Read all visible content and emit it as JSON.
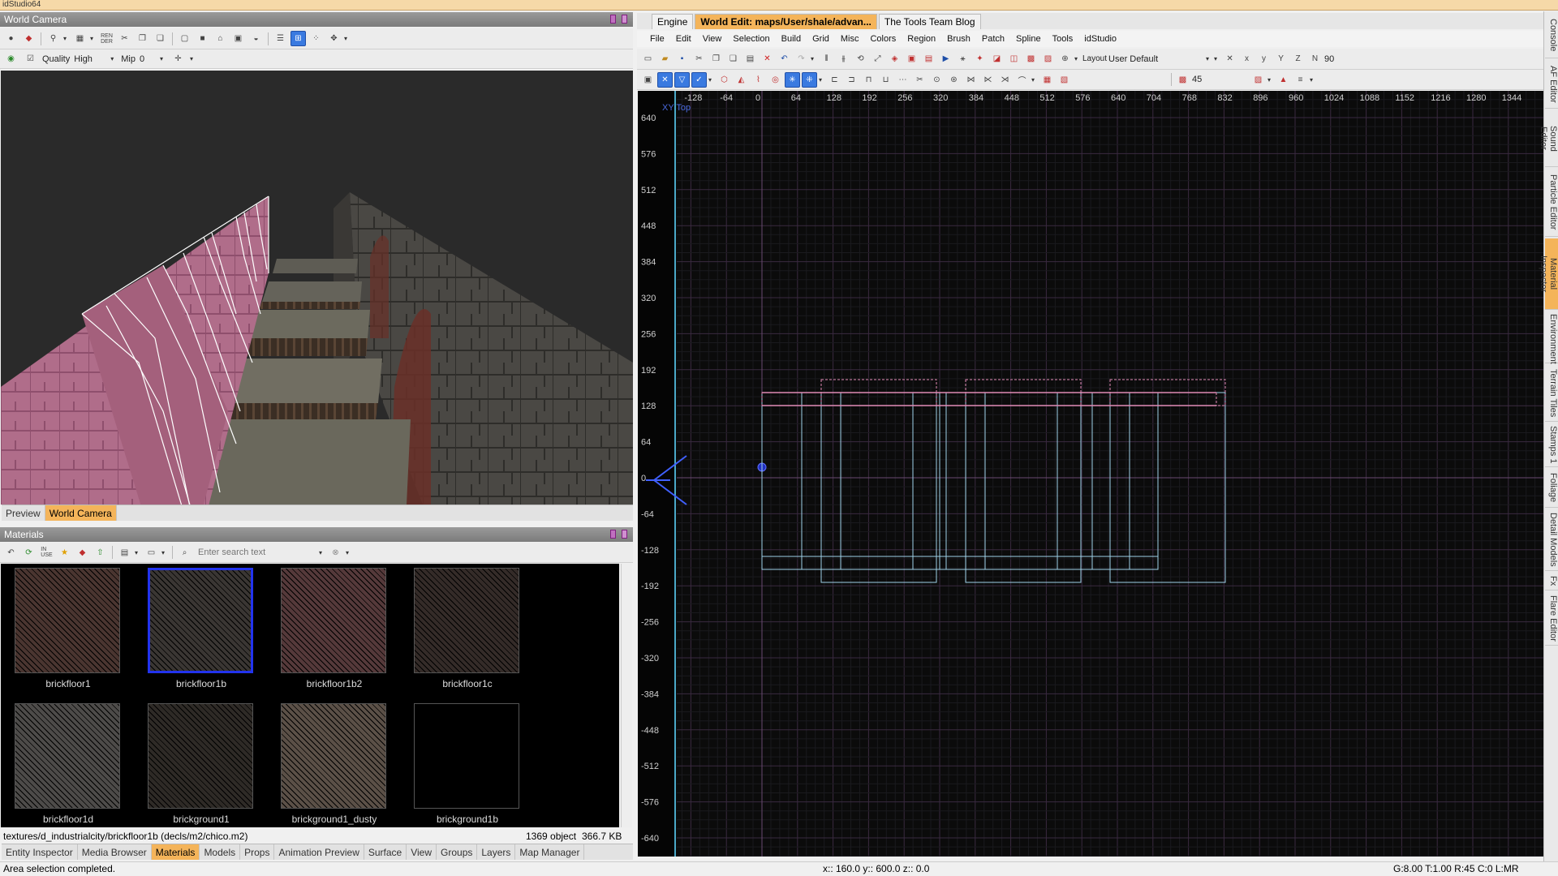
{
  "app": {
    "title": "idStudio64"
  },
  "camera_panel": {
    "title": "World Camera",
    "quality_label": "Quality",
    "quality_value": "High",
    "mip_label": "Mip",
    "mip_value": "0",
    "tabs": [
      {
        "label": "Preview"
      },
      {
        "label": "World Camera",
        "active": true
      }
    ]
  },
  "materials_panel": {
    "title": "Materials",
    "search_placeholder": "Enter search text",
    "items": [
      {
        "name": "brickfloor1",
        "color": "#4a3530"
      },
      {
        "name": "brickfloor1b",
        "color": "#3a3633",
        "selected": true
      },
      {
        "name": "brickfloor1b2",
        "color": "#55393a"
      },
      {
        "name": "brickfloor1c",
        "color": "#342b28"
      },
      {
        "name": "brickfloor1d",
        "color": "#4d4b49"
      },
      {
        "name": "brickground1",
        "color": "#2e2a26"
      },
      {
        "name": "brickground1_dusty",
        "color": "#5b5047"
      },
      {
        "name": "brickground1b",
        "color": "#000000"
      }
    ],
    "path": "textures/d_industrialcity/brickfloor1b  (decls/m2/chico.m2)",
    "object_count": "1369 object",
    "size": "366.7 KB"
  },
  "bottom_tabs": [
    {
      "label": "Entity Inspector"
    },
    {
      "label": "Media Browser"
    },
    {
      "label": "Materials",
      "active": true
    },
    {
      "label": "Models"
    },
    {
      "label": "Props"
    },
    {
      "label": "Animation Preview"
    },
    {
      "label": "Surface"
    },
    {
      "label": "View"
    },
    {
      "label": "Groups"
    },
    {
      "label": "Layers"
    },
    {
      "label": "Map Manager"
    }
  ],
  "status": {
    "message": "Area selection completed.",
    "coords": "x:: 160.0  y:: 600.0  z:: 0.0",
    "grid_info": "G:8.00 T:1.00 R:45 C:0 L:MR"
  },
  "doc_tabs": [
    {
      "label": "Engine"
    },
    {
      "label": "World Edit: maps/User/shale/advan...",
      "active": true
    },
    {
      "label": "The Tools Team Blog"
    }
  ],
  "menu": [
    "File",
    "Edit",
    "View",
    "Selection",
    "Build",
    "Grid",
    "Misc",
    "Colors",
    "Region",
    "Brush",
    "Patch",
    "Spline",
    "Tools",
    "idStudio"
  ],
  "layout": {
    "label": "Layout",
    "value": "User Default",
    "angle": "90"
  },
  "toolbar2": {
    "value": "45"
  },
  "ortho": {
    "view_label": "XY  Top",
    "x_ticks": [
      "-128",
      "-64",
      "0",
      "64",
      "128",
      "192",
      "256",
      "320",
      "384",
      "448",
      "512",
      "576",
      "640",
      "704",
      "768",
      "832",
      "896",
      "960",
      "1024",
      "1088",
      "1152",
      "1216",
      "1280",
      "1344"
    ],
    "y_ticks": [
      "640",
      "576",
      "512",
      "448",
      "384",
      "320",
      "256",
      "192",
      "128",
      "64",
      "0",
      "-64",
      "-128",
      "-192",
      "-256",
      "-320",
      "-384",
      "-448",
      "-512",
      "-576",
      "-640"
    ],
    "side_ticks": [
      "512",
      "448",
      "384",
      "320",
      "256",
      "192",
      "128",
      "64",
      "0",
      "-64",
      "-128",
      "-192",
      "-256",
      "-320",
      "-384"
    ]
  },
  "dock_tabs": [
    {
      "label": "Console"
    },
    {
      "label": "AF Editor"
    },
    {
      "label": "Sound Editor"
    },
    {
      "label": "Particle Editor"
    },
    {
      "label": "Material Inspector",
      "active": true
    },
    {
      "label": "Environment"
    },
    {
      "label": "Terrain Tiles"
    },
    {
      "label": "Stamps 1"
    },
    {
      "label": "Foliage"
    },
    {
      "label": "Detail Models"
    },
    {
      "label": "Fx"
    },
    {
      "label": "Flare Editor"
    }
  ]
}
